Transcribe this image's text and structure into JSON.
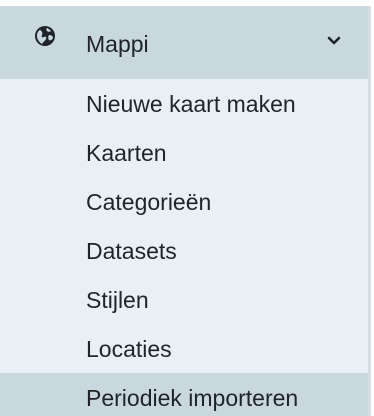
{
  "menu": {
    "title": "Mappi",
    "icon": "globe-icon",
    "toggle_icon": "chevron-down-icon",
    "items": [
      {
        "label": "Nieuwe kaart maken"
      },
      {
        "label": "Kaarten"
      },
      {
        "label": "Categorieën"
      },
      {
        "label": "Datasets"
      },
      {
        "label": "Stijlen"
      },
      {
        "label": "Locaties"
      },
      {
        "label": "Periodiek importeren",
        "active": true
      }
    ]
  },
  "colors": {
    "panel_bg": "#e8f0f5",
    "header_bg": "#c9d7df",
    "active_bg": "#c9d7df",
    "text": "#1f2428"
  }
}
